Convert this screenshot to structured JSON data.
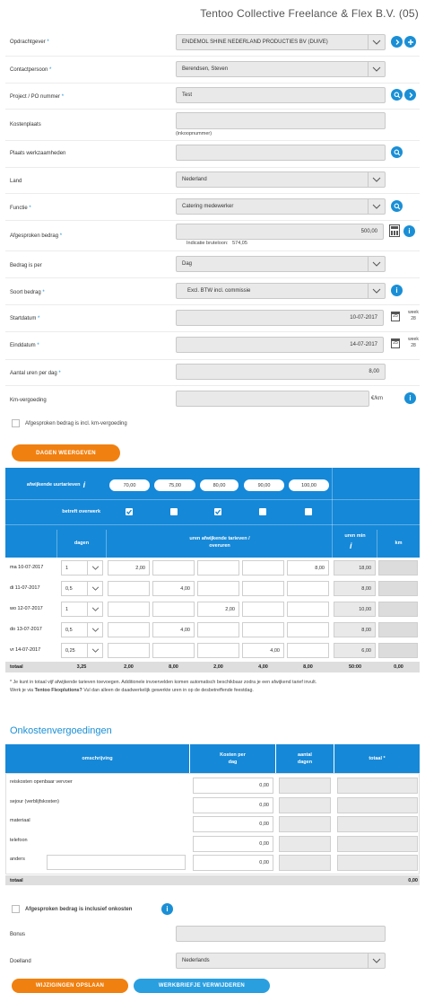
{
  "company": "Tentoo Collective Freelance & Flex B.V. (05)",
  "form": {
    "opdrachtgever": {
      "label": "Opdrachtgever",
      "value": "ENDEMOL SHINE NEDERLAND PRODUCTIES BV (DUIVE)"
    },
    "contactpersoon": {
      "label": "Contactpersoon",
      "value": "Berendsen, Steven"
    },
    "project": {
      "label": "Project / PO nummer",
      "value": "Test"
    },
    "kostenplaats": {
      "label": "Kostenplaats",
      "value": "",
      "hint": "(inkoopnummer)"
    },
    "plaats": {
      "label": "Plaats werkzaamheden",
      "value": ""
    },
    "land": {
      "label": "Land",
      "value": "Nederland"
    },
    "functie": {
      "label": "Functie",
      "value": "Catering medewerker"
    },
    "bedrag": {
      "label": "Afgesproken bedrag",
      "value": "500,00",
      "hint": "Indicatie bruteloon:",
      "hint_value": "574,05"
    },
    "bedrag_per": {
      "label": "Bedrag is per",
      "value": "Dag"
    },
    "soort": {
      "label": "Soort bedrag",
      "value": "Excl. BTW incl. commissie"
    },
    "startdatum": {
      "label": "Startdatum",
      "value": "10-07-2017",
      "cal": "25",
      "week_label": "week",
      "week": "28"
    },
    "einddatum": {
      "label": "Einddatum",
      "value": "14-07-2017",
      "cal": "25",
      "week_label": "week",
      "week": "28"
    },
    "uren": {
      "label": "Aantal uren per dag",
      "value": "8,00"
    },
    "km": {
      "label": "Km-vergoeding",
      "value": "",
      "unit": "€/km"
    },
    "km_check": "Afgesproken bedrag is incl. km-vergoeding",
    "dagen_button": "DAGEN WEERGEVEN"
  },
  "rates": {
    "afwijkend_label": "afwijkende uurtarieven",
    "overwerk_label": "betreft overwerk",
    "rates": [
      "70,00",
      "75,00",
      "80,00",
      "90,00",
      "100,00"
    ],
    "overwerk": [
      true,
      false,
      true,
      false,
      false
    ],
    "header_dagen": "dagen",
    "header_uren": "uren afwijkende tarieven / overuren",
    "header_urenmin": "uren min",
    "header_km": "km",
    "rows": [
      {
        "day": "ma  10-07-2017",
        "dagen": "1",
        "vals": [
          "2,00",
          "",
          "",
          "",
          "8,00"
        ],
        "uren": "18,00"
      },
      {
        "day": "di   11-07-2017",
        "dagen": "0,5",
        "vals": [
          "",
          "4,00",
          "",
          "",
          ""
        ],
        "uren": "8,00"
      },
      {
        "day": "wo  12-07-2017",
        "dagen": "1",
        "vals": [
          "",
          "",
          "2,00",
          "",
          ""
        ],
        "uren": "10,00"
      },
      {
        "day": "do  13-07-2017",
        "dagen": "0,5",
        "vals": [
          "",
          "4,00",
          "",
          "",
          ""
        ],
        "uren": "8,00"
      },
      {
        "day": "vr   14-07-2017",
        "dagen": "0,25",
        "vals": [
          "",
          "",
          "",
          "4,00",
          ""
        ],
        "uren": "6,00"
      }
    ],
    "totals": {
      "label": "totaal",
      "dagen": "3,25",
      "vals": [
        "2,00",
        "8,00",
        "2,00",
        "4,00",
        "8,00"
      ],
      "uren": "50:00",
      "km": "0,00"
    }
  },
  "footnote": {
    "line1": "* Je kunt in totaal vijf afwijkende tarieven toevoegen. Additionele invoervelden komen automatisch beschikbaar zodra je een afwijkend tarief invult.",
    "line2_pre": "Werk je via ",
    "line2_bold": "Tentoo Flexplutions?",
    "line2_post": " Vul dan alleen de daadwerkelijk gewerkte uren in op de desbetreffende feestdag."
  },
  "onkosten": {
    "title": "Onkostenvergoedingen",
    "h_omschrijving": "omschrijving",
    "h_kosten": "Kosten per dag",
    "h_aantal": "aantal dagen",
    "h_totaal": "totaal",
    "rows": [
      {
        "label": "reiskosten openbaar vervoer",
        "kosten": "0,00"
      },
      {
        "label": "sejour (verblijfskosten)",
        "kosten": "0,00"
      },
      {
        "label": "materiaal",
        "kosten": "0,00"
      },
      {
        "label": "telefoon",
        "kosten": "0,00"
      },
      {
        "label": "anders",
        "kosten": "0,00"
      }
    ],
    "totaal_label": "totaal",
    "totaal_value": "0,00"
  },
  "incl_onkosten": "Afgesproken bedrag is inclusief onkosten",
  "bonus": {
    "label": "Bonus",
    "value": ""
  },
  "doelland": {
    "label": "Doelland",
    "value": "Nederlands"
  },
  "buttons": {
    "save": "WIJZIGINGEN OPSLAAN",
    "delete": "WERKBRIEFJE VERWIJDEREN"
  }
}
